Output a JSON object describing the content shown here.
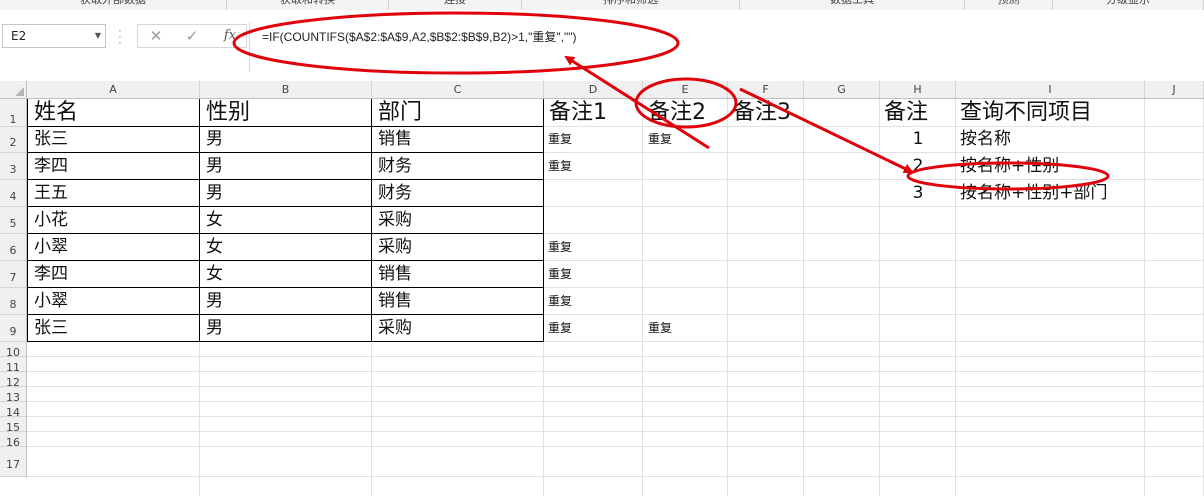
{
  "ribbon": {
    "groups": [
      "获取外部数据",
      "获取和转换",
      "连接",
      "排序和筛选",
      "数据工具",
      "预测",
      "分级显示"
    ]
  },
  "formula_bar": {
    "name_box": "E2",
    "cancel_icon": "✕",
    "enter_icon": "✓",
    "fx_label": "fx",
    "formula": "=IF(COUNTIFS($A$2:$A$9,A2,$B$2:$B$9,B2)>1,\"重复\",\"\")"
  },
  "columns": [
    "A",
    "B",
    "C",
    "D",
    "E",
    "F",
    "G",
    "H",
    "I",
    "J"
  ],
  "rows": [
    "1",
    "2",
    "3",
    "4",
    "5",
    "6",
    "7",
    "8",
    "9",
    "10",
    "11",
    "12",
    "13",
    "14",
    "15",
    "16",
    "17"
  ],
  "sheet": {
    "headers": {
      "A": "姓名",
      "B": "性别",
      "C": "部门",
      "D": "备注1",
      "E": "备注2",
      "F": "备注3",
      "H": "备注",
      "I": "查询不同项目"
    },
    "data_rows": [
      {
        "A": "张三",
        "B": "男",
        "C": "销售",
        "D": "重复",
        "E": "重复"
      },
      {
        "A": "李四",
        "B": "男",
        "C": "财务",
        "D": "重复",
        "E": ""
      },
      {
        "A": "王五",
        "B": "男",
        "C": "财务",
        "D": "",
        "E": ""
      },
      {
        "A": "小花",
        "B": "女",
        "C": "采购",
        "D": "",
        "E": ""
      },
      {
        "A": "小翠",
        "B": "女",
        "C": "采购",
        "D": "重复",
        "E": ""
      },
      {
        "A": "李四",
        "B": "女",
        "C": "销售",
        "D": "重复",
        "E": ""
      },
      {
        "A": "小翠",
        "B": "男",
        "C": "销售",
        "D": "重复",
        "E": ""
      },
      {
        "A": "张三",
        "B": "男",
        "C": "采购",
        "D": "重复",
        "E": "重复"
      }
    ],
    "notes": [
      {
        "H": "1",
        "I": "按名称"
      },
      {
        "H": "2",
        "I": "按名称+性别"
      },
      {
        "H": "3",
        "I": "按名称+性别+部门"
      }
    ]
  },
  "annotation_color": "#e0000c"
}
